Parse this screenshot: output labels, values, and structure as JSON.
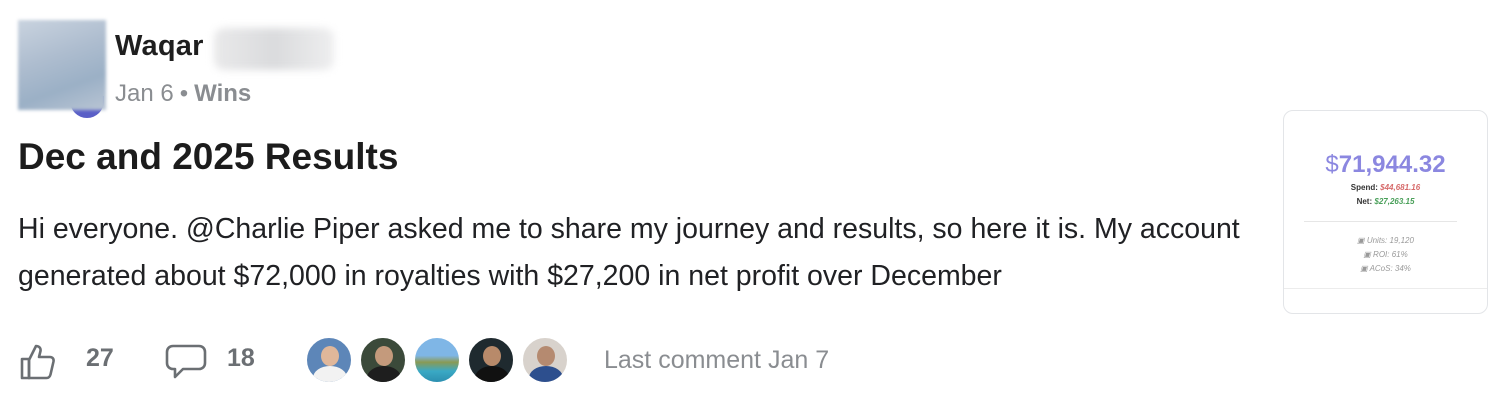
{
  "author": {
    "name": "Waqar"
  },
  "meta": {
    "date": "Jan 6",
    "separator": "•",
    "category": "Wins"
  },
  "post": {
    "title": "Dec and 2025 Results",
    "excerpt": "Hi everyone. @Charlie Piper asked me to share my journey and results, so here it is. My account generated about $72,000 in royalties with $27,200 in net profit over December"
  },
  "thumbnail": {
    "currency": "$",
    "total": "71,944.32",
    "spend_label": "Spend:",
    "spend_value": "$44,681.16",
    "net_label": "Net:",
    "net_value": "$27,263.15",
    "units": "Units: 19,120",
    "roi": "ROI: 61%",
    "acos": "ACoS: 34%"
  },
  "footer": {
    "like_count": "27",
    "comment_count": "18",
    "commenter_avatars": [
      "commenter-1",
      "commenter-2",
      "commenter-3",
      "commenter-4",
      "commenter-5"
    ],
    "last_comment": "Last comment Jan 7"
  },
  "icons": {
    "like": "thumbs-up-icon",
    "comment": "speech-bubble-icon"
  },
  "colors": {
    "accent": "#8b87e0",
    "spend": "#d76b6b",
    "net": "#4aa05a",
    "muted": "#8a8d91"
  }
}
